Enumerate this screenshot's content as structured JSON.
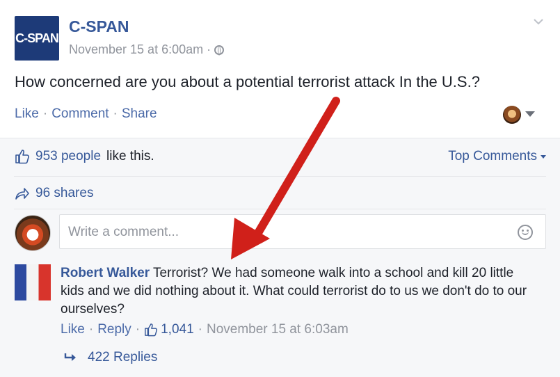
{
  "post": {
    "page_name": "C-SPAN",
    "logo_text": "C-SPAN",
    "timestamp": "November 15 at 6:00am",
    "time_separator": "·",
    "text": "How concerned are you about a potential terrorist attack In the U.S.?",
    "actions": {
      "like": "Like",
      "comment": "Comment",
      "share": "Share",
      "separator": "·"
    }
  },
  "reactions": {
    "likes_count": "953 people",
    "likes_suffix": "like this.",
    "top_comments": "Top Comments",
    "shares": "96 shares"
  },
  "comment_input": {
    "placeholder": "Write a comment..."
  },
  "comment": {
    "author": "Robert Walker",
    "text": "Terrorist? We had someone walk into a school and kill 20 little kids and we did nothing about it. What could terrorist do to us we don't do to our ourselves?",
    "like": "Like",
    "reply": "Reply",
    "likes_count": "1,041",
    "timestamp": "November 15 at 6:03am",
    "separator": "·",
    "replies": "422 Replies"
  },
  "colors": {
    "link_blue": "#365899",
    "action_blue": "#4b6aa8",
    "gray_text": "#90949c",
    "logo_bg": "#1d3a78",
    "arrow_red": "#d0201a"
  },
  "icons": {
    "globe": "globe-icon",
    "chevron": "chevron-down-icon",
    "thumbs_up": "thumbs-up-icon",
    "share_arrow": "share-arrow-icon",
    "smiley": "smiley-icon",
    "reply_arrow": "reply-arrow-icon"
  }
}
